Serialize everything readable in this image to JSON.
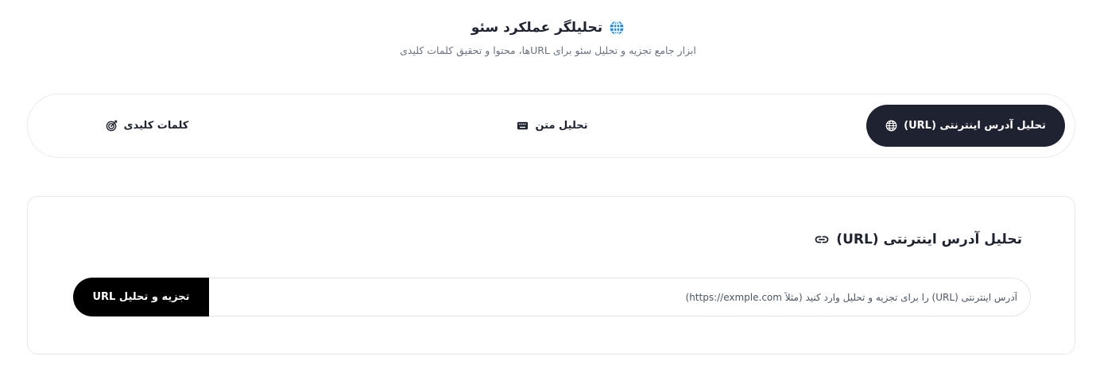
{
  "header": {
    "title": "تحلیلگر عملکرد سئو",
    "title_icon": "globe-network-icon",
    "subtitle": "ابزار جامع تجزیه و تحلیل سئو برای URLها، محتوا و تحقیق کلمات کلیدی"
  },
  "tabs": [
    {
      "label": "تحلیل آدرس اینترنتی (URL)",
      "icon": "globe-icon",
      "active": true
    },
    {
      "label": "تحلیل متن",
      "icon": "keyboard-icon",
      "active": false
    },
    {
      "label": "کلمات کلیدی",
      "icon": "target-icon",
      "active": false
    }
  ],
  "url_section": {
    "title": "تحلیل آدرس اینترنتی (URL)",
    "title_icon": "link-icon",
    "input_placeholder": "آدرس اینترنتی (URL) را برای تجزیه و تحلیل وارد کنید (مثلاً https://exmple.com)",
    "input_value": "",
    "button_label": "تجزیه و تحلیل URL"
  },
  "colors": {
    "accent": "#1e88e5",
    "active_tab_bg": "#1f2231",
    "button_bg": "#000000",
    "muted_text": "#6b7280"
  }
}
